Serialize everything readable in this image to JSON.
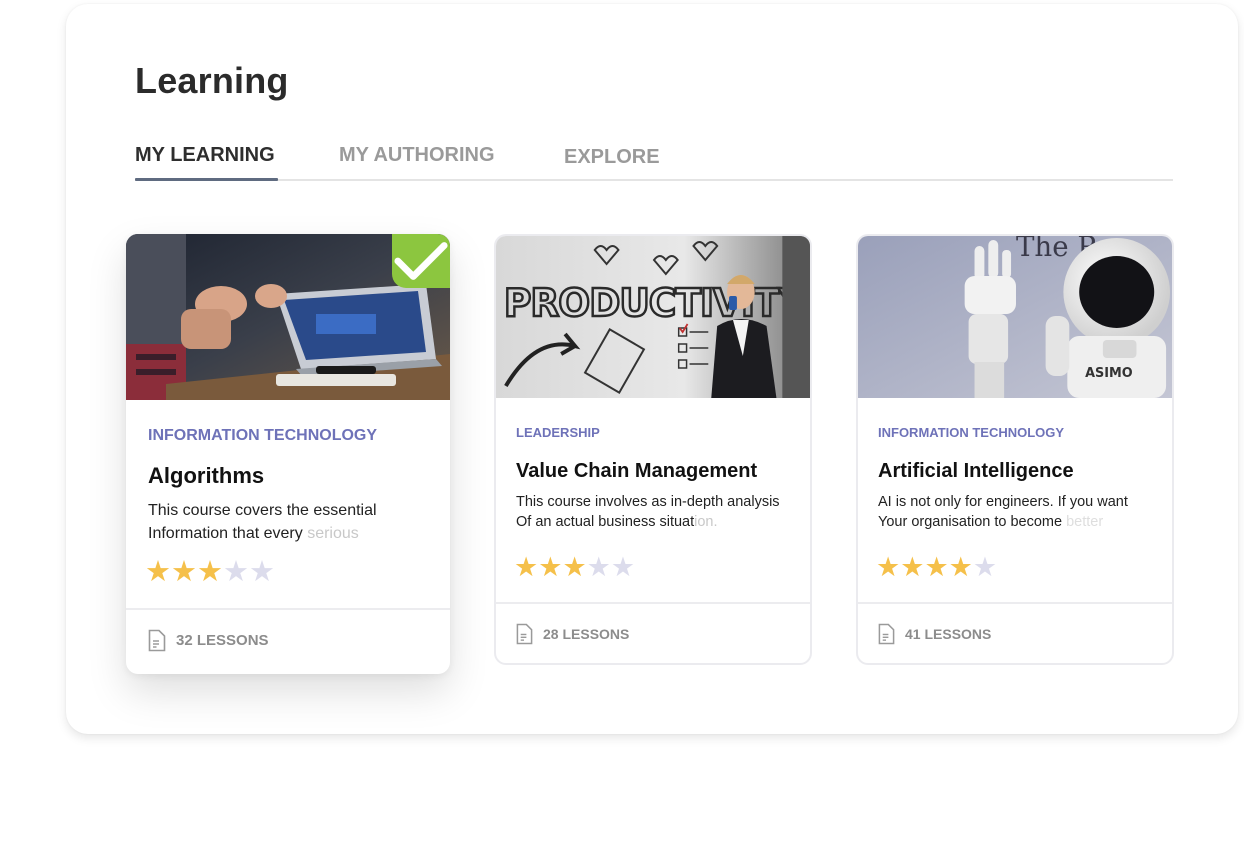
{
  "page": {
    "title": "Learning"
  },
  "tabs": [
    {
      "label": "MY LEARNING",
      "active": true
    },
    {
      "label": "MY AUTHORING",
      "active": false
    },
    {
      "label": "EXPLORE",
      "active": false
    }
  ],
  "colors": {
    "accent_category": "#6e72b8",
    "star_on": "#f5c04a",
    "star_off": "#dcdcec",
    "completed_badge": "#8cc63f",
    "tab_underline": "#5f6b80"
  },
  "courses": [
    {
      "category": "INFORMATION TECHNOLOGY",
      "title": "Algorithms",
      "desc_line1": "This course covers the essential",
      "desc_line2": "Information that every ",
      "desc_fade": "serious",
      "rating": 3,
      "rating_max": 5,
      "lessons": "32 LESSONS",
      "completed": true,
      "image": "meeting-laptop-photo"
    },
    {
      "category": "LEADERSHIP",
      "title": "Value Chain Management",
      "desc_line1": "This course involves as in-depth analysis",
      "desc_line2": "Of an actual business situat",
      "desc_fade": "ion.",
      "rating": 3,
      "rating_max": 5,
      "lessons": "28 LESSONS",
      "completed": false,
      "image": "productivity-wall-photo",
      "image_text": "PRODUCTIVITY"
    },
    {
      "category": "INFORMATION TECHNOLOGY",
      "title": "Artificial Intelligence",
      "desc_line1": "AI is not only for engineers. If you want",
      "desc_line2": "Your organisation to become ",
      "desc_fade": "better",
      "rating": 4,
      "rating_max": 5,
      "lessons": "41 LESSONS",
      "completed": false,
      "image": "asimo-robot-photo",
      "image_text": "ASIMO"
    }
  ]
}
